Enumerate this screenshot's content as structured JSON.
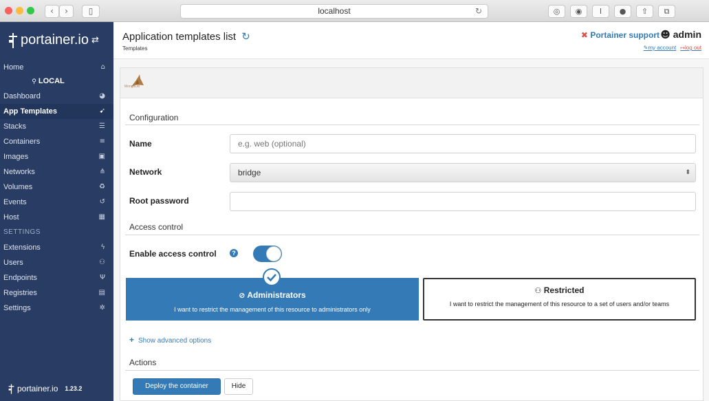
{
  "browser": {
    "url": "localhost",
    "back_glyph": "‹",
    "forward_glyph": "›",
    "sidebar_glyph": "▯",
    "reload_glyph": "↻",
    "traffic_colors": [
      "#fc605c",
      "#fdbc40",
      "#34c84a"
    ],
    "toolbar_glyphs": [
      "◎",
      "◉",
      "I",
      "●",
      "⇧",
      "⧉"
    ]
  },
  "sidebar": {
    "logo_text": "portainer.io",
    "logo_toggle_glyph": "⇄",
    "home": {
      "label": "Home",
      "icon": "⌂"
    },
    "endpoint_label": "LOCAL",
    "endpoint_glyph": "⚲",
    "items": [
      {
        "label": "Dashboard",
        "icon": "◕"
      },
      {
        "label": "App Templates",
        "icon": "➹"
      },
      {
        "label": "Stacks",
        "icon": "☰"
      },
      {
        "label": "Containers",
        "icon": "≡"
      },
      {
        "label": "Images",
        "icon": "▣"
      },
      {
        "label": "Networks",
        "icon": "⋔"
      },
      {
        "label": "Volumes",
        "icon": "♻"
      },
      {
        "label": "Events",
        "icon": "↺"
      },
      {
        "label": "Host",
        "icon": "▦"
      }
    ],
    "settings_heading": "SETTINGS",
    "settings_items": [
      {
        "label": "Extensions",
        "icon": "ϟ"
      },
      {
        "label": "Users",
        "icon": "⚇"
      },
      {
        "label": "Endpoints",
        "icon": "Ψ"
      },
      {
        "label": "Registries",
        "icon": "▤"
      },
      {
        "label": "Settings",
        "icon": "✲"
      }
    ],
    "footer_text": "portainer.io",
    "version": "1.23.2",
    "colors": {
      "background": "#293c63",
      "active": "#22355a"
    }
  },
  "header": {
    "title": "Application templates list",
    "refresh_glyph": "↻",
    "breadcrumb": "Templates",
    "support_glyph": "✖",
    "support_label": "Portainer support",
    "user_glyph": "☻",
    "user": "admin",
    "account_link": "my account",
    "account_glyph": "✎",
    "logout_link": "log out",
    "logout_glyph": "↦"
  },
  "template": {
    "logo_caption": "MongoDB"
  },
  "form": {
    "configuration_heading": "Configuration",
    "name_label": "Name",
    "name_placeholder": "e.g. web (optional)",
    "network_label": "Network",
    "network_value": "bridge",
    "select_arrow": "⬍",
    "password_label": "Root password",
    "password_value": "",
    "access_heading": "Access control",
    "enable_access_label": "Enable access control",
    "help_glyph": "?",
    "access_control_enabled": true
  },
  "access": {
    "admin": {
      "icon": "⊘",
      "title": "Administrators",
      "description": "I want to restrict the management of this resource to administrators only",
      "selected": true
    },
    "restricted": {
      "icon": "⚇",
      "title": "Restricted",
      "description": "I want to restrict the management of this resource to a set of users and/or teams",
      "selected": false
    },
    "check_glyph": "✔"
  },
  "advanced_link": {
    "plus": "+",
    "label": "Show advanced options"
  },
  "actions": {
    "heading": "Actions",
    "deploy_label": "Deploy the container",
    "hide_label": "Hide"
  },
  "colors": {
    "accent": "#337ab7",
    "danger": "#d9534f"
  }
}
